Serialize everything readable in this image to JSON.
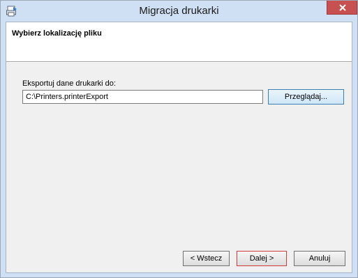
{
  "window": {
    "title": "Migracja drukarki",
    "icon": "printer-migration-icon",
    "close_icon": "close-icon"
  },
  "header": {
    "title": "Wybierz lokalizację pliku"
  },
  "export": {
    "label": "Eksportuj dane drukarki do:",
    "path_value": "C:\\Printers.printerExport",
    "browse_label": "Przeglądaj..."
  },
  "footer": {
    "back_label": "< Wstecz",
    "next_label": "Dalej >",
    "cancel_label": "Anuluj"
  },
  "colors": {
    "title_bar": "#cfe0f4",
    "close_button": "#c75050",
    "focused_button_border": "#d33b3b",
    "hover_button_border": "#3c7fb1"
  }
}
